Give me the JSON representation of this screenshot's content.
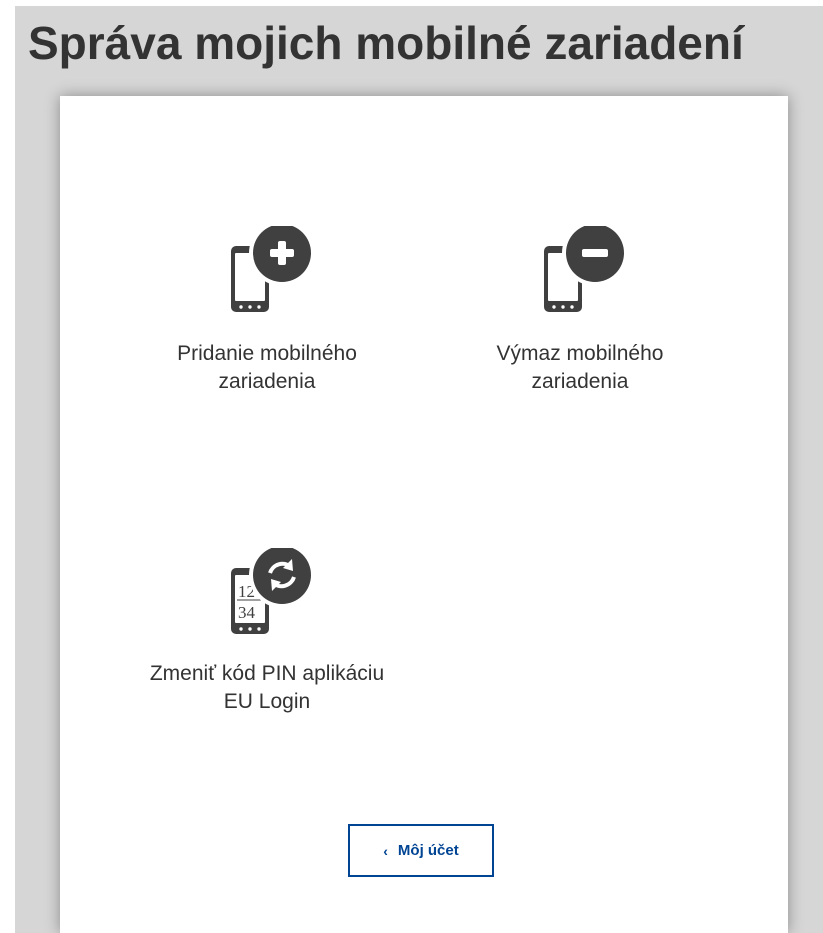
{
  "page": {
    "title": "Správa mojich mobilné zariadení"
  },
  "tiles": [
    {
      "label_line1": "Pridanie mobilného",
      "label_line2": "zariadenia",
      "icon": "phone-add-icon"
    },
    {
      "label_line1": "Výmaz mobilného",
      "label_line2": "zariadenia",
      "icon": "phone-remove-icon"
    },
    {
      "label_line1": "Zmeniť kód PIN aplikáciu",
      "label_line2": "EU Login",
      "icon": "phone-pin-change-icon",
      "pin_digits_top": "12",
      "pin_digits_bottom": "34"
    }
  ],
  "back_button": {
    "label": "Môj účet",
    "icon": "chevron-left-icon"
  },
  "colors": {
    "background": "#d6d6d6",
    "card": "#ffffff",
    "text": "#333333",
    "icon": "#404040",
    "accent": "#004494"
  }
}
